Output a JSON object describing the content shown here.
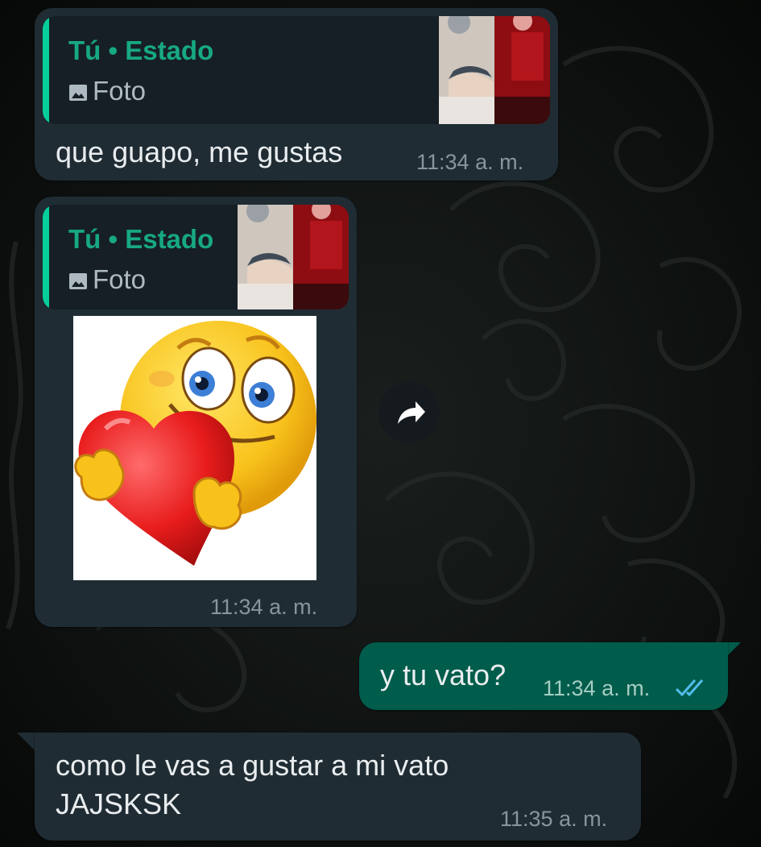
{
  "chat": {
    "messages": [
      {
        "direction": "incoming",
        "quote": {
          "title": "Tú • Estado",
          "type_label": "Foto",
          "icon": "image-icon"
        },
        "text": "que guapo, me gustas",
        "time": "11:34 a. m."
      },
      {
        "direction": "incoming",
        "quote": {
          "title": "Tú • Estado",
          "type_label": "Foto",
          "icon": "image-icon"
        },
        "sticker": "emoji-hugging-heart",
        "time": "11:34 a. m."
      },
      {
        "direction": "outgoing",
        "text": "y tu vato?",
        "time": "11:34 a. m.",
        "status": "read-double-check-icon"
      },
      {
        "direction": "incoming",
        "text_lines": [
          "como le vas a gustar a mi vato",
          "JAJSKSK"
        ],
        "time": "11:35 a. m."
      }
    ],
    "forward_icon": "forward-arrow-icon"
  },
  "colors": {
    "incoming_bubble": "#1f2c33",
    "outgoing_bubble": "#005c4b",
    "quote_accent": "#06cf9c",
    "quote_title": "#17a884",
    "read_ticks": "#53bdeb"
  }
}
